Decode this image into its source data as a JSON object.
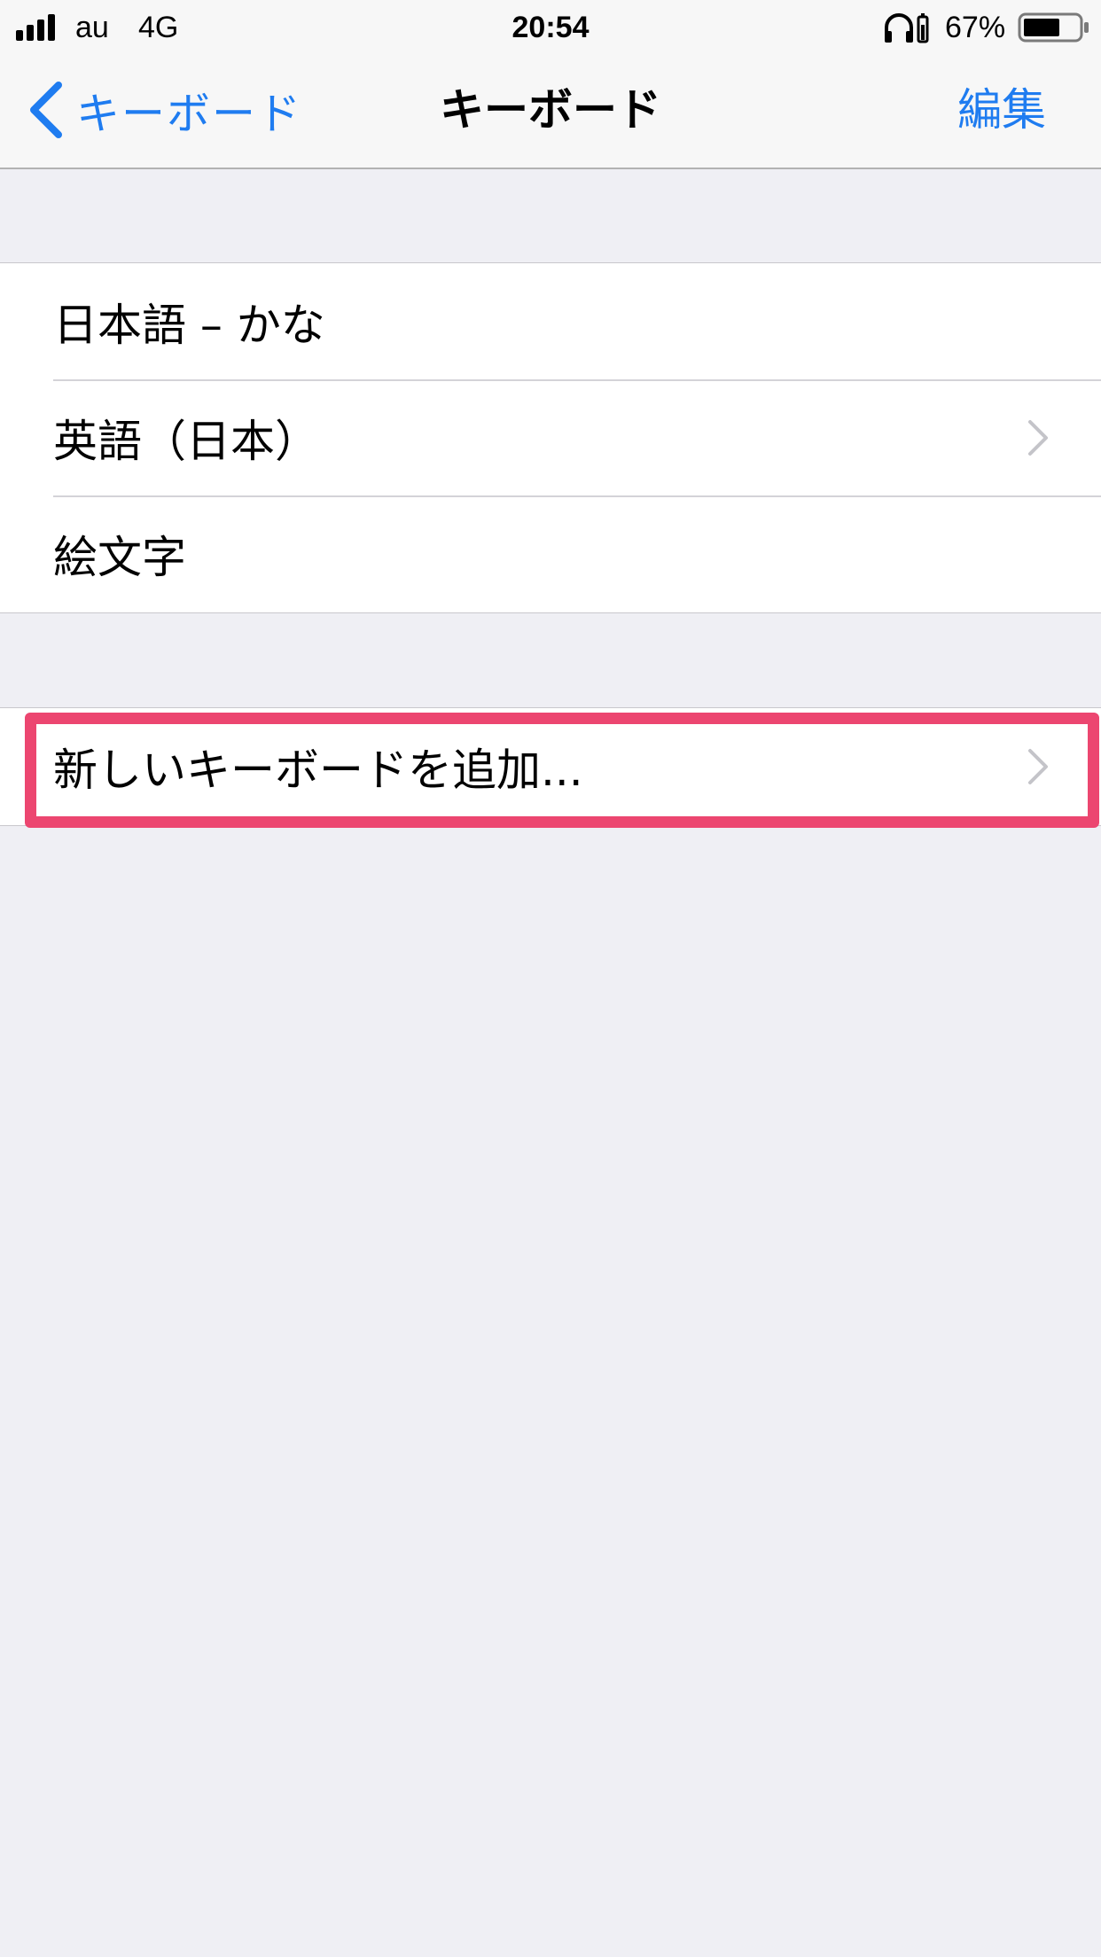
{
  "status_bar": {
    "carrier": "au",
    "network": "4G",
    "time": "20:54",
    "battery": "67%",
    "signal_bars": 4,
    "battery_level": 0.67
  },
  "nav": {
    "back_label": "キーボード",
    "title": "キーボード",
    "edit_label": "編集"
  },
  "keyboards": [
    {
      "label": "日本語 – かな",
      "has_chevron": false
    },
    {
      "label": "英語（日本）",
      "has_chevron": true
    },
    {
      "label": "絵文字",
      "has_chevron": false
    }
  ],
  "add_keyboard": {
    "label": "新しいキーボードを追加...",
    "highlight_color": "#ec4670"
  },
  "colors": {
    "accent": "#1f7cf0",
    "background": "#efeff4"
  }
}
